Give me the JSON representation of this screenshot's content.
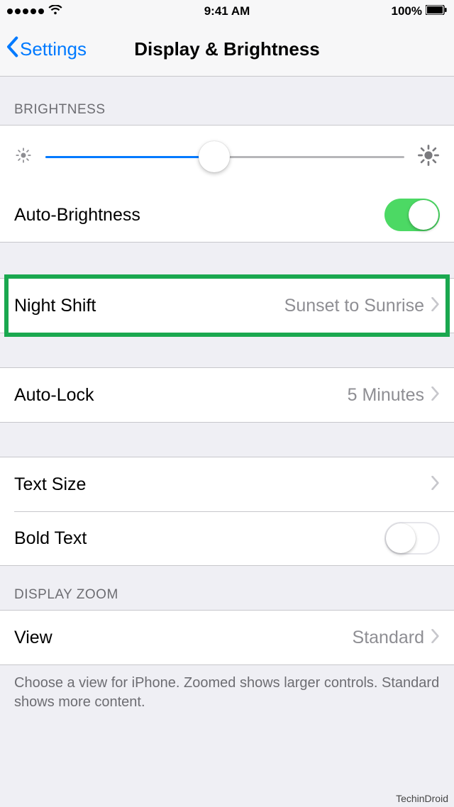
{
  "status": {
    "time": "9:41 AM",
    "battery_pct": "100%"
  },
  "nav": {
    "back_label": "Settings",
    "title": "Display & Brightness"
  },
  "sections": {
    "brightness_header": "BRIGHTNESS",
    "display_zoom_header": "DISPLAY ZOOM"
  },
  "rows": {
    "auto_brightness": {
      "label": "Auto-Brightness",
      "on": true
    },
    "night_shift": {
      "label": "Night Shift",
      "value": "Sunset to Sunrise"
    },
    "auto_lock": {
      "label": "Auto-Lock",
      "value": "5 Minutes"
    },
    "text_size": {
      "label": "Text Size"
    },
    "bold_text": {
      "label": "Bold Text",
      "on": false
    },
    "view": {
      "label": "View",
      "value": "Standard"
    }
  },
  "footer": "Choose a view for iPhone. Zoomed shows larger controls. Standard shows more content.",
  "watermark": "TechinDroid"
}
